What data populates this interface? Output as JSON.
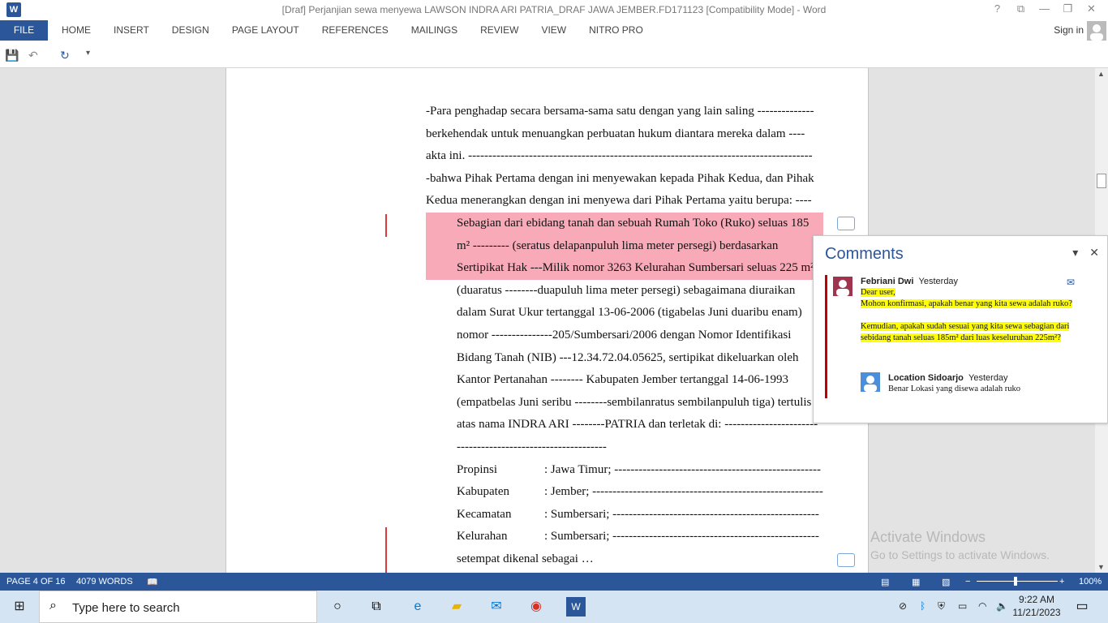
{
  "window": {
    "app_icon": "W",
    "title": "[Draf] Perjanjian sewa menyewa LAWSON INDRA ARI PATRIA_DRAF JAWA JEMBER.FD171123 [Compatibility Mode] - Word",
    "controls": [
      "?",
      "⧉",
      "—",
      "❐",
      "✕"
    ]
  },
  "ribbon": {
    "file_tab": "FILE",
    "tabs": [
      "HOME",
      "INSERT",
      "DESIGN",
      "PAGE LAYOUT",
      "REFERENCES",
      "MAILINGS",
      "REVIEW",
      "VIEW",
      "NITRO PRO"
    ],
    "sign_in": "Sign in"
  },
  "quick_access": {
    "save_icon": "💾",
    "undo_icon": "↶",
    "redo_icon": "↻",
    "customize_icon": "▾"
  },
  "document": {
    "lines": [
      "-Para penghadap secara bersama-sama satu dengan yang lain saling --------------",
      "berkehendak untuk menuangkan perbuatan hukum diantara mereka dalam ----",
      "akta ini. -------------------------------------------------------------------------------------",
      "-bahwa Pihak Pertama dengan ini menyewakan kepada Pihak Kedua, dan Pihak",
      "Kedua menerangkan dengan ini menyewa dari Pihak Pertama yaitu berupa: ----"
    ],
    "highlighted_lines": [
      "Sebagian dari ebidang tanah dan sebuah Rumah Toko (Ruko) seluas 185",
      "m² --------- (seratus delapanpuluh lima meter persegi) berdasarkan",
      "Sertipikat Hak ---Milik nomor 3263 Kelurahan Sumbersari seluas 225 m²"
    ],
    "indented_lines": [
      "(duaratus --------duapuluh lima meter persegi) sebagaimana diuraikan",
      "dalam Surat Ukur tertanggal 13-06-2006 (tigabelas Juni duaribu enam)",
      "nomor ---------------205/Sumbersari/2006 dengan Nomor Identifikasi",
      "Bidang Tanah (NIB) ---12.34.72.04.05625, sertipikat dikeluarkan oleh",
      "Kantor Pertanahan -------- Kabupaten Jember tertanggal 14-06-1993",
      "(empatbelas Juni seribu --------sembilanratus sembilanpuluh tiga) tertulis",
      "atas nama INDRA ARI --------PATRIA dan terletak di: -----------------------",
      "-------------------------------------"
    ],
    "fields": [
      {
        "label": "Propinsi",
        "value": ":  Jawa Timur; ---------------------------------------------------"
      },
      {
        "label": "Kabupaten",
        "value": ":  Jember; ---------------------------------------------------------"
      },
      {
        "label": "Kecamatan",
        "value": ":  Sumbersari; ---------------------------------------------------"
      },
      {
        "label": "Kelurahan",
        "value": ":  Sumbersari; ---------------------------------------------------"
      }
    ],
    "last_line": "setempat dikenal sebagai …"
  },
  "comments_pane": {
    "title": "Comments",
    "comment1": {
      "author": "Febriani Dwi",
      "time": "Yesterday",
      "p1": "Dear user,",
      "p2": "Mohon konfirmasi, apakah benar yang kita sewa adalah ruko?",
      "p3": "Kemudian, apakah sudah sesuai yang kita sewa sebagian dari sebidang tanah seluas 185m² dari luas keseluruhan 225m²?"
    },
    "reply": {
      "author": "Location Sidoarjo",
      "time": "Yesterday",
      "text": "Benar Lokasi yang disewa adalah ruko"
    }
  },
  "watermark": {
    "line1": "Activate Windows",
    "line2": "Go to Settings to activate Windows."
  },
  "status": {
    "page": "PAGE 4 OF 16",
    "words": "4079 WORDS",
    "zoom_minus": "−",
    "zoom_plus": "+",
    "zoom": "100%",
    "zoom_level_percent": 100
  },
  "taskbar": {
    "search_placeholder": "Type here to search",
    "time": "9:22 AM",
    "date": "11/21/2023"
  },
  "colors": {
    "accent": "#2b579a",
    "highlight_pink": "#f8aab9",
    "highlight_yellow": "#ffff00",
    "comment_bar": "#c00000"
  }
}
